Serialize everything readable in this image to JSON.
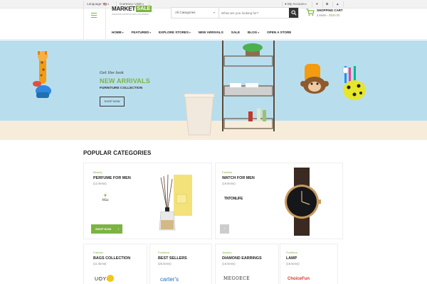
{
  "topbar": {
    "language_label": "Language:",
    "language_flag": "🇺🇸",
    "currency_label": "Currency: USD",
    "account_label": "My Account"
  },
  "header": {
    "logo_part1": "MARKET",
    "logo_part2": "SALE",
    "tagline": "AWESOME SHOPPING WITH THE MARKET",
    "search": {
      "category": "All Categories",
      "placeholder": "What are you looking for?"
    },
    "cart": {
      "title": "SHOPPING CART",
      "items": "2 items -",
      "total": "$539.00"
    }
  },
  "nav": [
    {
      "label": "HOME",
      "arrow": "▾"
    },
    {
      "label": "FEATURED",
      "arrow": "▾"
    },
    {
      "label": "EXPLORE STORES",
      "arrow": "▾"
    },
    {
      "label": "NEW ARRIVALS",
      "arrow": ""
    },
    {
      "label": "SALE",
      "arrow": ""
    },
    {
      "label": "BLOG",
      "arrow": "▾"
    },
    {
      "label": "OPEN A STORE",
      "arrow": ""
    }
  ],
  "hero": {
    "pretitle": "Get the look",
    "title": "NEW ARRIVALS",
    "subtitle": "FURNITURE COLLECTION",
    "button": "SHOP NOW"
  },
  "popular": {
    "title": "POPULAR CATEGORIES",
    "cards": [
      {
        "tag": "Beauty",
        "name": "PERFUME FOR MEN",
        "count": "(12 items)",
        "brand": "Miz",
        "button": "SHOP NOW"
      },
      {
        "tag": "Fashion",
        "name": "WATCH FOR MEN",
        "count": "(19 items)",
        "brand": "TNTONLIFE"
      },
      {
        "tag": "Fashion",
        "name": "BAGS COLLECTION",
        "count": "(11 items)",
        "brand": "UOYO"
      },
      {
        "tag": "Furniture",
        "name": "BEST SELLERS",
        "count": "(26 items)",
        "brand": "carter's"
      },
      {
        "tag": "Jewelry",
        "name": "DIAMOND EARRINGS",
        "count": "(16 items)",
        "brand": "MEGOECE"
      },
      {
        "tag": "Furniture",
        "name": "LAMP",
        "count": "(18 items)",
        "brand": "ChoiceFun"
      }
    ]
  },
  "colors": {
    "accent": "#7cb342",
    "hero_bg": "#b8deee",
    "floor": "#f6ecd9"
  }
}
